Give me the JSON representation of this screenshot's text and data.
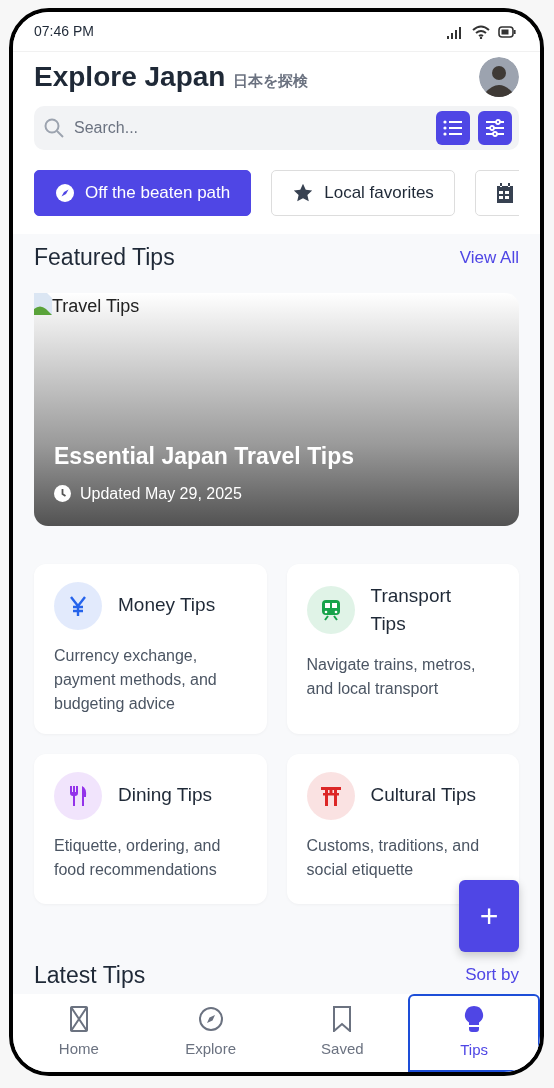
{
  "status_bar": {
    "time": "07:46 PM"
  },
  "header": {
    "title": "Explore Japan",
    "subtitle": "日本を探検"
  },
  "search": {
    "placeholder": "Search..."
  },
  "chips": [
    {
      "label": "Off the beaten path",
      "selected": true
    },
    {
      "label": "Local favorites",
      "selected": false
    },
    {
      "selected": false
    }
  ],
  "featured": {
    "heading": "Featured Tips",
    "link": "View All",
    "image_alt": "Travel Tips",
    "title": "Essential Japan Travel Tips",
    "updated": "Updated May 29, 2025"
  },
  "categories": [
    {
      "title": "Money Tips",
      "description": "Currency exchange, payment methods, and budgeting advice",
      "color": "#2563eb"
    },
    {
      "title": "Transport Tips",
      "description": "Navigate trains, metros, and local transport",
      "color": "#16a34a"
    },
    {
      "title": "Dining Tips",
      "description": "Etiquette, ordering, and food recommendations",
      "color": "#9333ea"
    },
    {
      "title": "Cultural Tips",
      "description": "Customs, traditions, and social etiquette",
      "color": "#dc2626"
    }
  ],
  "latest": {
    "heading": "Latest Tips",
    "link": "Sort by"
  },
  "fab": {
    "label": "+"
  },
  "bottom_nav": [
    {
      "label": "Home",
      "selected": false
    },
    {
      "label": "Explore",
      "selected": false
    },
    {
      "label": "Saved",
      "selected": false
    },
    {
      "label": "Tips",
      "selected": true
    }
  ]
}
